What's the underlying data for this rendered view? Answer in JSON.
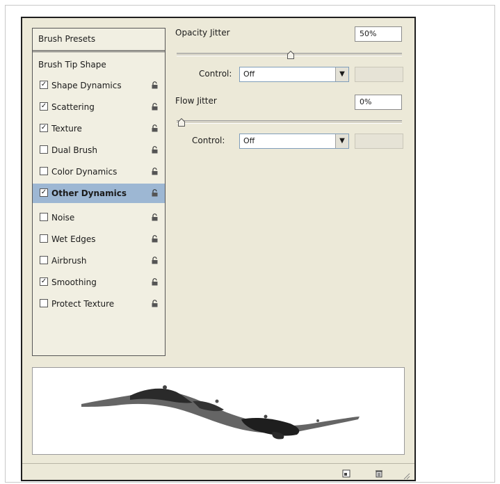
{
  "left_list": {
    "presets_label": "Brush Presets",
    "tip_shape_label": "Brush Tip Shape",
    "items": [
      {
        "label": "Shape Dynamics",
        "checked": "✓"
      },
      {
        "label": "Scattering",
        "checked": "✓"
      },
      {
        "label": "Texture",
        "checked": "✓"
      },
      {
        "label": "Dual Brush",
        "checked": ""
      },
      {
        "label": "Color Dynamics",
        "checked": ""
      },
      {
        "label": "Other Dynamics",
        "checked": "✓"
      },
      {
        "label": "Noise",
        "checked": ""
      },
      {
        "label": "Wet Edges",
        "checked": ""
      },
      {
        "label": "Airbrush",
        "checked": ""
      },
      {
        "label": "Smoothing",
        "checked": "✓"
      },
      {
        "label": "Protect Texture",
        "checked": ""
      }
    ]
  },
  "opacity": {
    "label": "Opacity Jitter",
    "value": "50%",
    "slider_fraction": 0.5,
    "control_label": "Control:",
    "control_value": "Off"
  },
  "flow": {
    "label": "Flow Jitter",
    "value": "0%",
    "slider_fraction": 0.0,
    "control_label": "Control:",
    "control_value": "Off"
  },
  "icons": {
    "lock": "lock-icon",
    "new": "new-preset-icon",
    "trash": "trash-icon",
    "grip": "resize-grip-icon",
    "dropdown": "chevron-down-icon"
  },
  "colors": {
    "selected_row": "#9db7d3",
    "panel_bg": "#ece9d8"
  }
}
